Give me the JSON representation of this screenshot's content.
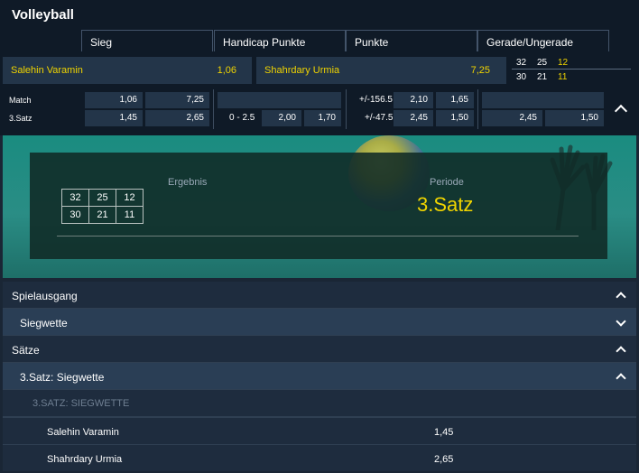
{
  "header": {
    "title": "Volleyball"
  },
  "tabs": [
    "Sieg",
    "Handicap Punkte",
    "Punkte",
    "Gerade/Ungerade"
  ],
  "teams": [
    {
      "name": "Salehin Varamin",
      "odds": "1,06"
    },
    {
      "name": "Shahrdary Urmia",
      "odds": "7,25"
    }
  ],
  "mini_score": {
    "row1": [
      "32",
      "25",
      "12"
    ],
    "row2": [
      "30",
      "21",
      "11"
    ]
  },
  "markets": {
    "rows": [
      {
        "label": "Match",
        "sieg": [
          "1,06",
          "7,25"
        ],
        "handicap": {
          "line": "",
          "odds": [
            "",
            ""
          ]
        },
        "punkte": {
          "line": "+/-156.5",
          "odds": [
            "2,10",
            "1,65"
          ]
        },
        "gerade": [
          "",
          ""
        ]
      },
      {
        "label": "3.Satz",
        "sieg": [
          "1,45",
          "2,65"
        ],
        "handicap": {
          "line": "0 - 2.5",
          "odds": [
            "2,00",
            "1,70"
          ]
        },
        "punkte": {
          "line": "+/-47.5",
          "odds": [
            "2,45",
            "1,50"
          ]
        },
        "gerade": [
          "2,45",
          "1,50"
        ]
      }
    ]
  },
  "scoreboard": {
    "ergebnis_label": "Ergebnis",
    "periode_label": "Periode",
    "periode_value": "3.Satz",
    "grid": [
      [
        "32",
        "25",
        "12"
      ],
      [
        "30",
        "21",
        "11"
      ]
    ]
  },
  "sections": [
    {
      "label": "Spielausgang",
      "expanded": true
    },
    {
      "label": "Siegwette",
      "expanded": false
    },
    {
      "label": "Sätze",
      "expanded": true
    },
    {
      "label": "3.Satz: Siegwette",
      "expanded": true
    }
  ],
  "market_detail": {
    "heading": "3.SATZ: SIEGWETTE",
    "rows": [
      {
        "name": "Salehin Varamin",
        "odds": "1,45"
      },
      {
        "name": "Shahrdary Urmia",
        "odds": "2,65"
      }
    ]
  },
  "colors": {
    "accent": "#f0d400",
    "panel": "#233549",
    "background": "#0f1a27"
  }
}
